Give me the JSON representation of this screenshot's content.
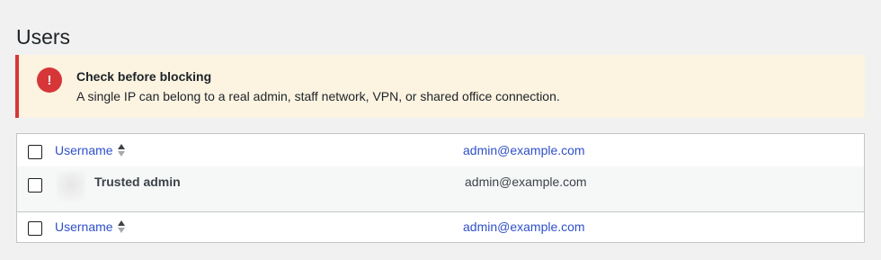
{
  "page": {
    "title": "Users"
  },
  "notice": {
    "icon": "exclamation-icon",
    "icon_glyph": "!",
    "title": "Check before blocking",
    "text": "A single IP can belong to a real admin, staff network, VPN, or shared office connection."
  },
  "table": {
    "header": {
      "username_label": "Username",
      "email_label": "admin@example.com"
    },
    "rows": [
      {
        "name": "Trusted admin",
        "email": "admin@example.com"
      }
    ],
    "footer": {
      "username_label": "Username",
      "email_label": "admin@example.com"
    }
  },
  "colors": {
    "danger": "#d63638",
    "link": "#2f50c8",
    "notice_bg": "#fcf3e1"
  }
}
